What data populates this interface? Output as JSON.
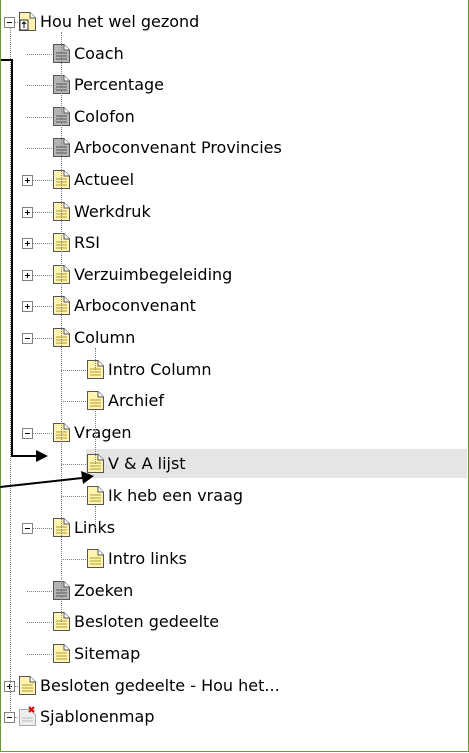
{
  "tree": {
    "root": {
      "label": "Hou het wel gezond"
    },
    "items": [
      {
        "key": "coach",
        "label": "Coach"
      },
      {
        "key": "percentage",
        "label": "Percentage"
      },
      {
        "key": "colofon",
        "label": "Colofon"
      },
      {
        "key": "arboconvenant-provincies",
        "label": "Arboconvenant Provincies"
      },
      {
        "key": "actueel",
        "label": "Actueel"
      },
      {
        "key": "werkdruk",
        "label": "Werkdruk"
      },
      {
        "key": "rsi",
        "label": "RSI"
      },
      {
        "key": "verzuimbegeleiding",
        "label": "Verzuimbegeleiding"
      },
      {
        "key": "arboconvenant",
        "label": "Arboconvenant"
      },
      {
        "key": "column",
        "label": "Column"
      },
      {
        "key": "intro-column",
        "label": "Intro Column"
      },
      {
        "key": "archief",
        "label": "Archief"
      },
      {
        "key": "vragen",
        "label": "Vragen"
      },
      {
        "key": "v-a-lijst",
        "label": "V & A lijst"
      },
      {
        "key": "ik-heb-een-vraag",
        "label": "Ik heb een vraag"
      },
      {
        "key": "links",
        "label": "Links"
      },
      {
        "key": "intro-links",
        "label": "Intro links"
      },
      {
        "key": "zoeken",
        "label": "Zoeken"
      },
      {
        "key": "besloten-gedeelte",
        "label": "Besloten gedeelte"
      },
      {
        "key": "sitemap",
        "label": "Sitemap"
      },
      {
        "key": "besloten-gedeelte-hou",
        "label": "Besloten gedeelte - Hou het..."
      },
      {
        "key": "sjablonenmap",
        "label": "Sjablonenmap"
      }
    ],
    "selected": "V & A lijst"
  },
  "colors": {
    "frame_border": "#6a9a2f",
    "selection_bg": "#e5e5e5",
    "page_icon_fill": "#fff4b0",
    "page_icon_dark": "#a8a8a8"
  },
  "icons": {
    "page": "page-icon",
    "gray_page": "gray-page-icon",
    "root": "root-page-icon",
    "template_folder": "template-folder-icon",
    "expand": "plus-toggle-icon",
    "collapse": "minus-toggle-icon"
  }
}
